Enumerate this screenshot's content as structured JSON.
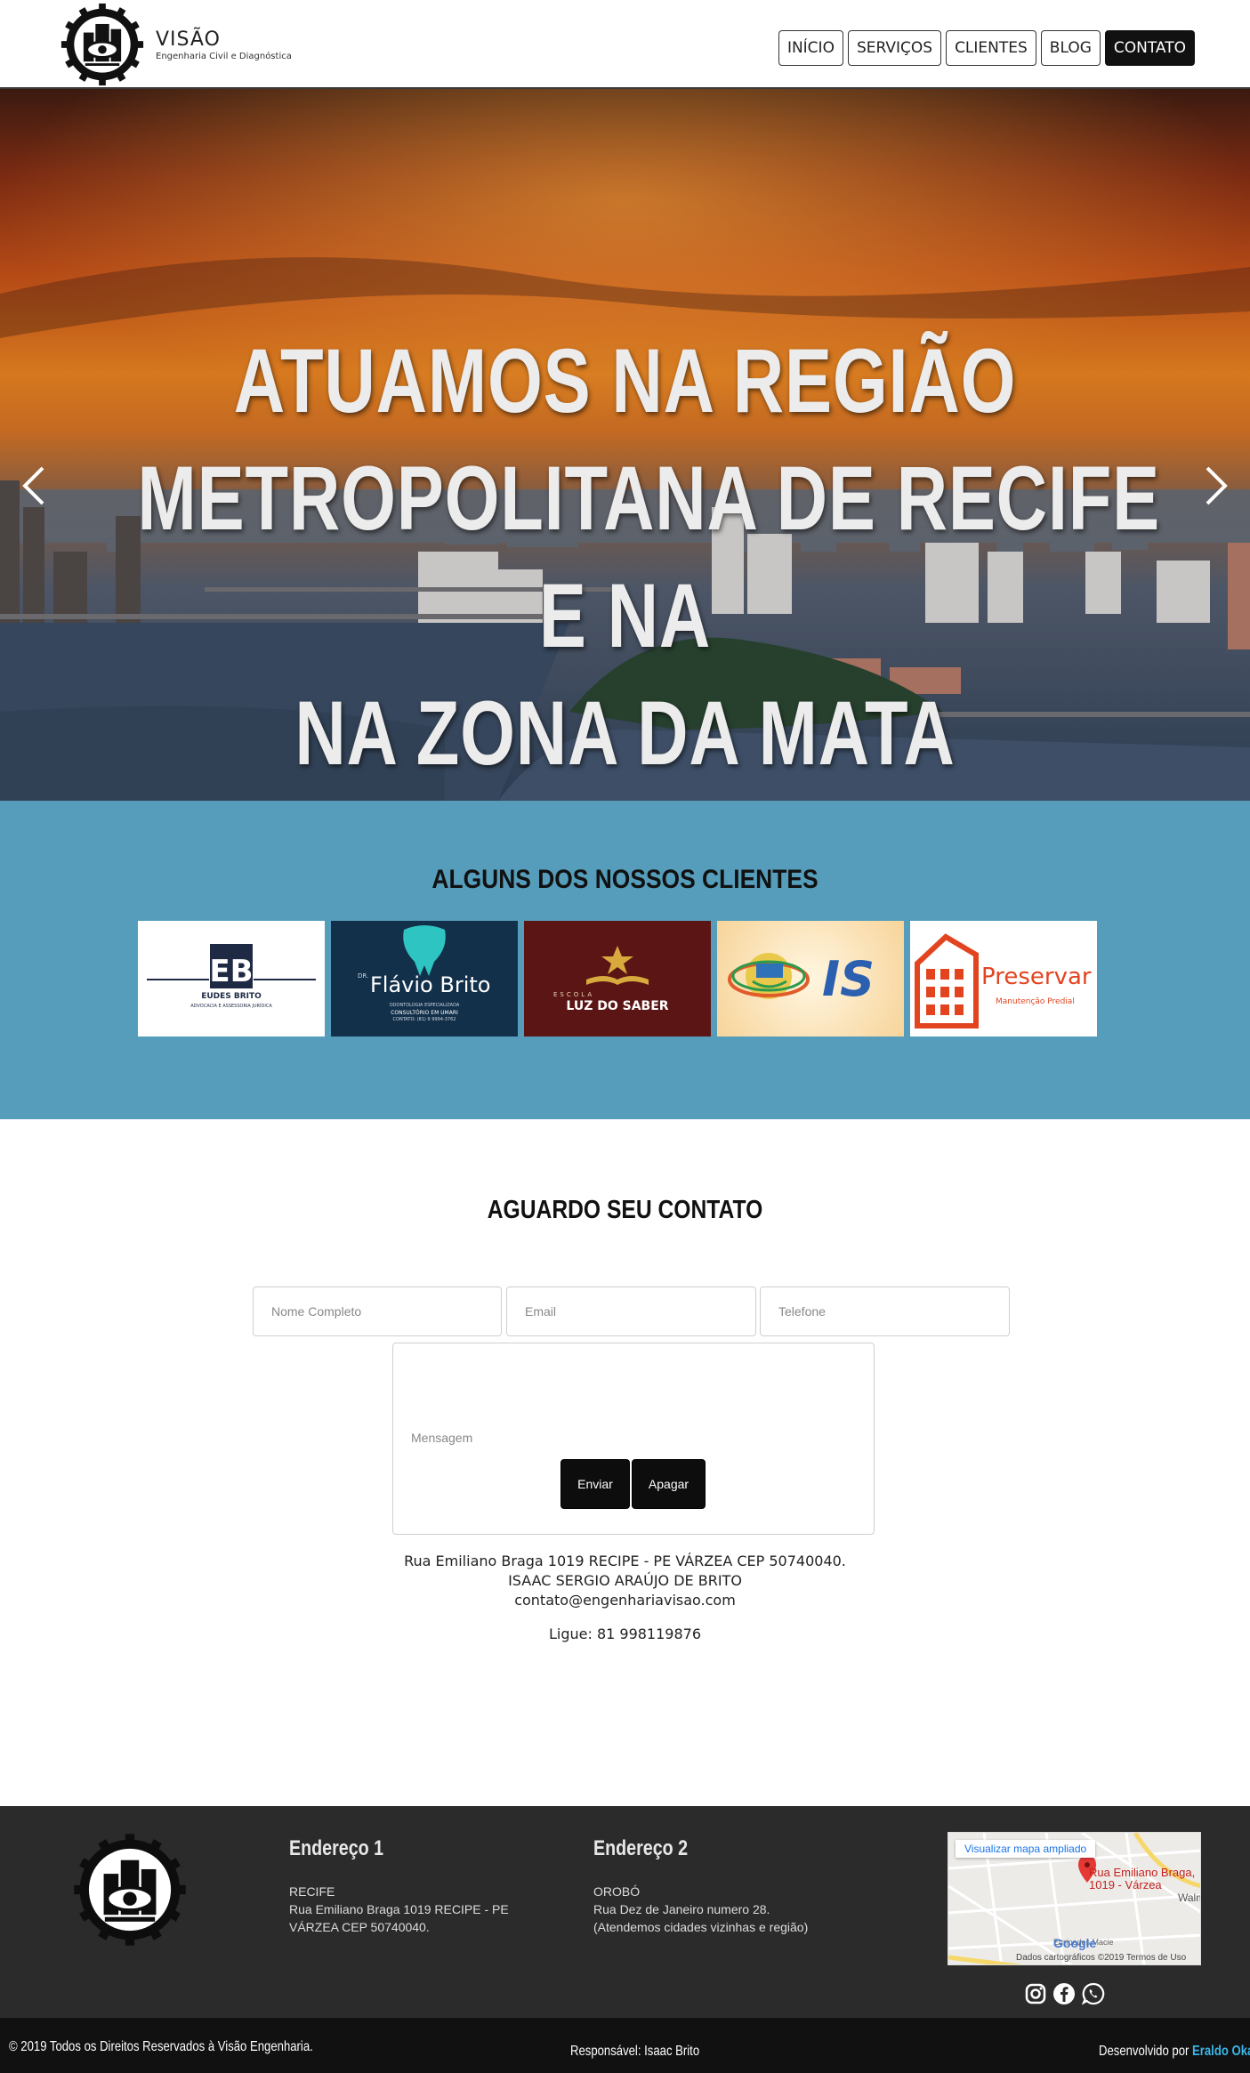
{
  "header": {
    "logo_title": "VISÃO",
    "logo_subtitle": "Engenharia Civil e Diagnóstica",
    "nav": [
      "INÍCIO",
      "SERVIÇOS",
      "CLIENTES",
      "BLOG",
      "CONTATO"
    ],
    "active_nav": "CONTATO"
  },
  "hero": {
    "lines": [
      "ATUAMOS NA REGIÃO",
      "METROPOLITANA DE RECIFE",
      "E NA",
      "NA ZONA DA MATA"
    ],
    "prev_icon": "chevron-left-icon",
    "next_icon": "chevron-right-icon"
  },
  "clients": {
    "title": "ALGUNS DOS NOSSOS CLIENTES",
    "logos": [
      {
        "name": "EUDES BRITO",
        "tag": "ADVOCACIA E ASSESSORIA JURÍDICA",
        "mark": "EB",
        "bg": "#ffffff"
      },
      {
        "name": "Flávio Brito",
        "prefix": "DR.",
        "tag": "ODONTOLOGIA ESPECIALIZADA",
        "tag2": "CONSULTÓRIO EM UMARI",
        "tag3": "CONTATO: (81) 9 9994-3762",
        "bg": "#13304b"
      },
      {
        "name": "LUZ DO SABER",
        "prefix": "ESCOLA",
        "bg": "#5c1515"
      },
      {
        "name": "IS",
        "bg": "#fde7c2"
      },
      {
        "name": "Preservar",
        "tag": "Manutenção Predial",
        "bg": "#ffffff"
      }
    ]
  },
  "contact": {
    "title": "AGUARDO SEU CONTATO",
    "fields": {
      "name_placeholder": "Nome Completo",
      "email_placeholder": "Email",
      "phone_placeholder": "Telefone",
      "message_placeholder": "Mensagem"
    },
    "address": "Rua Emiliano Braga 1019 RECIPE - PE VÁRZEA CEP 50740040.",
    "person": "ISAAC SERGIO ARAÚJO DE BRITO",
    "email": "contato@engenhariavisao.com",
    "phone": "Ligue: 81 998119876",
    "send_label": "Enviar",
    "clear_label": "Apagar"
  },
  "footer": {
    "address1": {
      "heading": "Endereço 1",
      "city": "RECIFE",
      "line1": "Rua Emiliano Braga 1019 RECIPE - PE",
      "line2": "VÁRZEA CEP 50740040."
    },
    "address2": {
      "heading": "Endereço 2",
      "city": "OROBÓ",
      "line1": "Rua Dez de Janeiro numero 28.",
      "line2": "(Atendemos cidades vizinhas e região)"
    },
    "map": {
      "link": "Visualizar mapa ampliado",
      "label_line1": "Rua Emiliano Braga,",
      "label_line2": "1019 - Várzea",
      "street": "Walm",
      "street2": "Eurípedes Macie",
      "attribution": "Dados cartográficos ©2019   Termos de Uso",
      "brand": "Google"
    },
    "social_icons": [
      "instagram-icon",
      "facebook-icon",
      "whatsapp-icon"
    ]
  },
  "bottom_bar": {
    "copyright": "© 2019 Todos os Direitos Reservados à Visão Engenharia.",
    "responsible": "Responsável: Isaac Brito",
    "developed_prefix": "Desenvolvido por",
    "developer": "Eraldo Oka"
  },
  "colors": {
    "clients_bg": "#559dbb",
    "footer_bg": "#2b2b2b",
    "bottom_bar_bg": "#111111",
    "developer_link": "#3cb5e6"
  }
}
